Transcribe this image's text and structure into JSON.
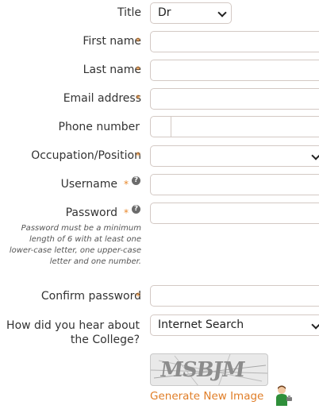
{
  "form": {
    "title": {
      "label": "Title",
      "value": "Dr"
    },
    "first_name": {
      "label": "First name",
      "value": ""
    },
    "last_name": {
      "label": "Last name",
      "value": ""
    },
    "email": {
      "label": "Email address",
      "value": ""
    },
    "phone": {
      "label": "Phone number",
      "value": ""
    },
    "occupation": {
      "label": "Occupation/Position",
      "value": ""
    },
    "username": {
      "label": "Username",
      "value": ""
    },
    "password": {
      "label": "Password",
      "value": "",
      "note": "Password must be a minimum length of 6 with at least one lower-case letter, one upper-case letter and one number."
    },
    "confirm_password": {
      "label": "Confirm password",
      "value": ""
    },
    "referral": {
      "label_line1": "How did you hear about",
      "label_line2": "the College?",
      "value": "Internet Search"
    },
    "required_marker": "*",
    "help_icon": "?"
  },
  "captcha": {
    "text": "MSBJM",
    "generate_label": "Generate New Image"
  },
  "icons": {
    "help": "question-circle-icon",
    "dropdown": "chevron-down-icon",
    "audio": "speaker-person-icon"
  },
  "colors": {
    "accent": "#e07e28",
    "border": "#d3c9c4",
    "help": "#6b6b6b"
  }
}
